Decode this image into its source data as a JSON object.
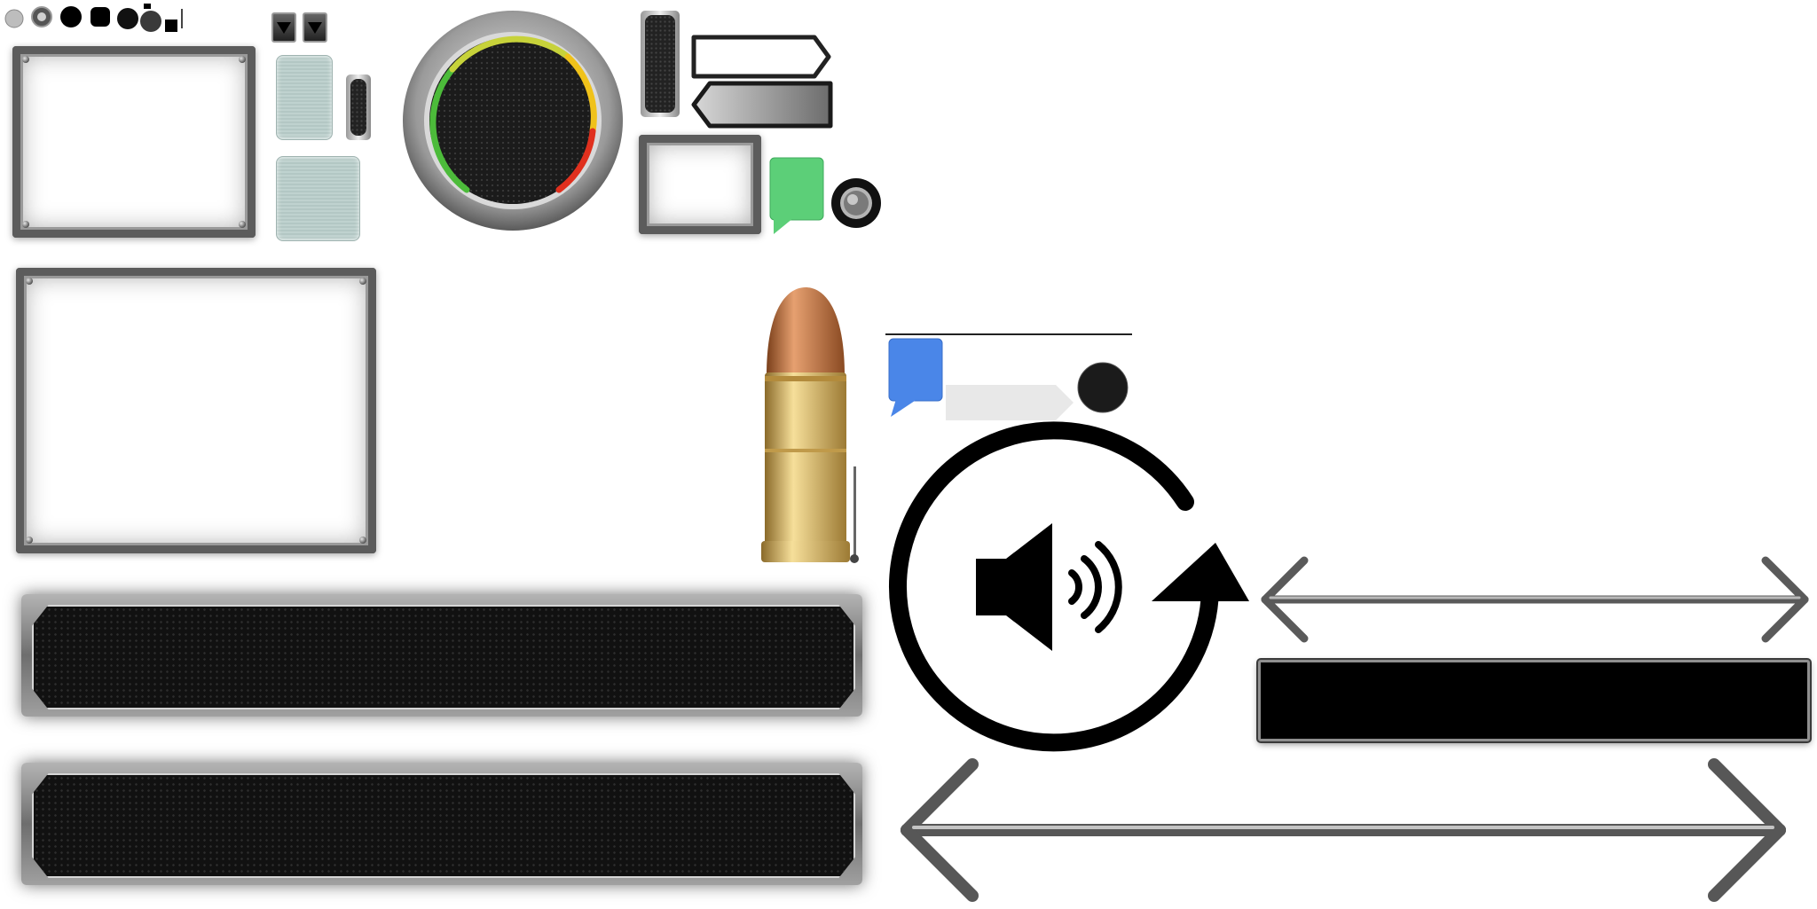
{
  "sprite_sheet": {
    "colors": {
      "steel_dark": "#4a4a4a",
      "steel_light": "#9c9c9c",
      "panel_black": "#111111",
      "tile_pale": "#bfd2cf",
      "chat_green": "#5ccf78",
      "chat_blue": "#4a86e8",
      "gauge_green": "#4cbb3a",
      "gauge_yellow": "#f0c21a",
      "gauge_red": "#e0301e",
      "bullet_copper": "#c4763c",
      "bullet_brass": "#d8b15a",
      "icon_black": "#000000"
    },
    "icons": [
      "grey-dot-icon",
      "steel-dot-icon",
      "black-dot-icon",
      "rounded-square-icon",
      "dropdown-arrow-icon",
      "gauge-dial-icon",
      "chat-bubble-icon",
      "metal-knob-icon",
      "bullet-icon",
      "speaker-refresh-icon",
      "double-arrow-icon"
    ]
  }
}
